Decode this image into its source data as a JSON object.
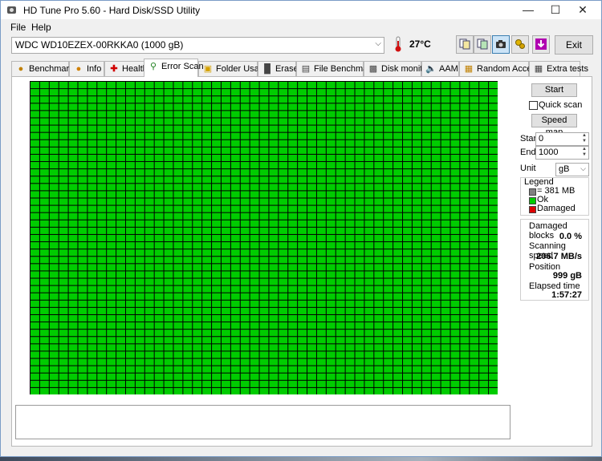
{
  "window": {
    "title": "HD Tune Pro 5.60 - Hard Disk/SSD Utility",
    "controls": [
      "—",
      "☐",
      "✕"
    ]
  },
  "menu": {
    "file": "File",
    "help": "Help"
  },
  "toolbar": {
    "drive": "WDC WD10EZEX-00RKKA0 (1000 gB)",
    "temperature": "27°C",
    "exit_label": "Exit"
  },
  "tabs": [
    {
      "label": "Benchmark",
      "icon": "benchmark-icon"
    },
    {
      "label": "Info",
      "icon": "info-icon"
    },
    {
      "label": "Health",
      "icon": "health-icon"
    },
    {
      "label": "Error Scan",
      "icon": "error-scan-icon"
    },
    {
      "label": "Folder Usage",
      "icon": "folder-icon"
    },
    {
      "label": "Erase",
      "icon": "erase-icon"
    },
    {
      "label": "File Benchmark",
      "icon": "file-benchmark-icon"
    },
    {
      "label": "Disk monitor",
      "icon": "disk-monitor-icon"
    },
    {
      "label": "AAM",
      "icon": "aam-icon"
    },
    {
      "label": "Random Access",
      "icon": "random-access-icon"
    },
    {
      "label": "Extra tests",
      "icon": "extra-tests-icon"
    }
  ],
  "active_tab": "Error Scan",
  "scan": {
    "start_button": "Start",
    "quick_scan_label": "Quick scan",
    "quick_scan_checked": false,
    "speed_map_button": "Speed map",
    "start_label": "Start",
    "start_value": "0",
    "end_label": "End",
    "end_value": "1000",
    "unit_label": "Unit",
    "unit_value": "gB"
  },
  "legend": {
    "title": "Legend",
    "items": [
      {
        "label": "= 381 MB",
        "color": "#808080"
      },
      {
        "label": "Ok",
        "color": "#00cc00"
      },
      {
        "label": "Damaged",
        "color": "#dd0000"
      }
    ]
  },
  "stats": {
    "damaged_blocks_label": "Damaged blocks",
    "damaged_blocks_value": "0.0 %",
    "scanning_speed_label": "Scanning speed",
    "scanning_speed_value": "206.7 MB/s",
    "position_label": "Position",
    "position_value": "999 gB",
    "elapsed_label": "Elapsed time",
    "elapsed_value": "1:57:27"
  },
  "colors": {
    "ok_block": "#00cc00",
    "grid_line": "#000000",
    "accent": "#3c7fb1"
  }
}
